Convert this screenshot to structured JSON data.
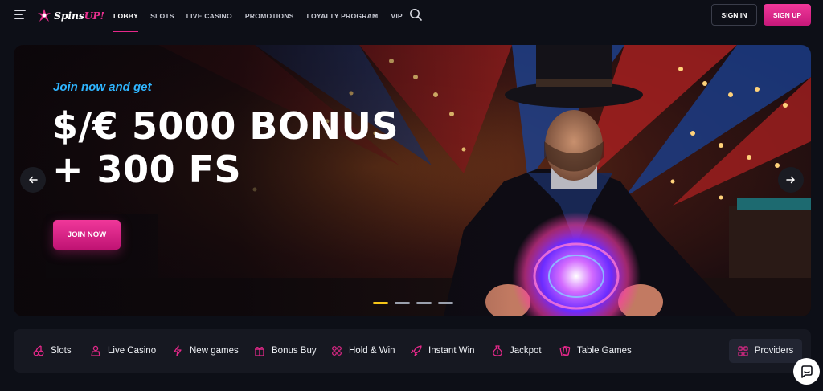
{
  "header": {
    "logo": {
      "part1": "Spins",
      "part2": "UP!"
    },
    "nav": [
      {
        "label": "LOBBY",
        "active": true
      },
      {
        "label": "SLOTS",
        "active": false
      },
      {
        "label": "LIVE CASINO",
        "active": false
      },
      {
        "label": "PROMOTIONS",
        "active": false
      },
      {
        "label": "LOYALTY PROGRAM",
        "active": false
      },
      {
        "label": "VIP",
        "active": false
      }
    ],
    "signin_label": "SIGN IN",
    "signup_label": "SIGN UP"
  },
  "hero": {
    "kicker": "Join now and get",
    "title_line1": "$/€ 5000 BONUS",
    "title_line2": "+ 300 FS",
    "cta_label": "JOIN NOW",
    "slides_total": 4,
    "active_slide": 1
  },
  "categories": [
    {
      "label": "Slots",
      "icon": "cherries-icon"
    },
    {
      "label": "Live Casino",
      "icon": "dealer-icon"
    },
    {
      "label": "New games",
      "icon": "lightning-icon"
    },
    {
      "label": "Bonus Buy",
      "icon": "gift-icon"
    },
    {
      "label": "Hold & Win",
      "icon": "coins-icon"
    },
    {
      "label": "Instant Win",
      "icon": "rocket-icon"
    },
    {
      "label": "Jackpot",
      "icon": "money-bag-icon"
    },
    {
      "label": "Table Games",
      "icon": "cards-icon"
    }
  ],
  "providers_label": "Providers",
  "colors": {
    "accent": "#e5288a",
    "kicker": "#2fb5ff",
    "active_dot": "#f5c518"
  }
}
